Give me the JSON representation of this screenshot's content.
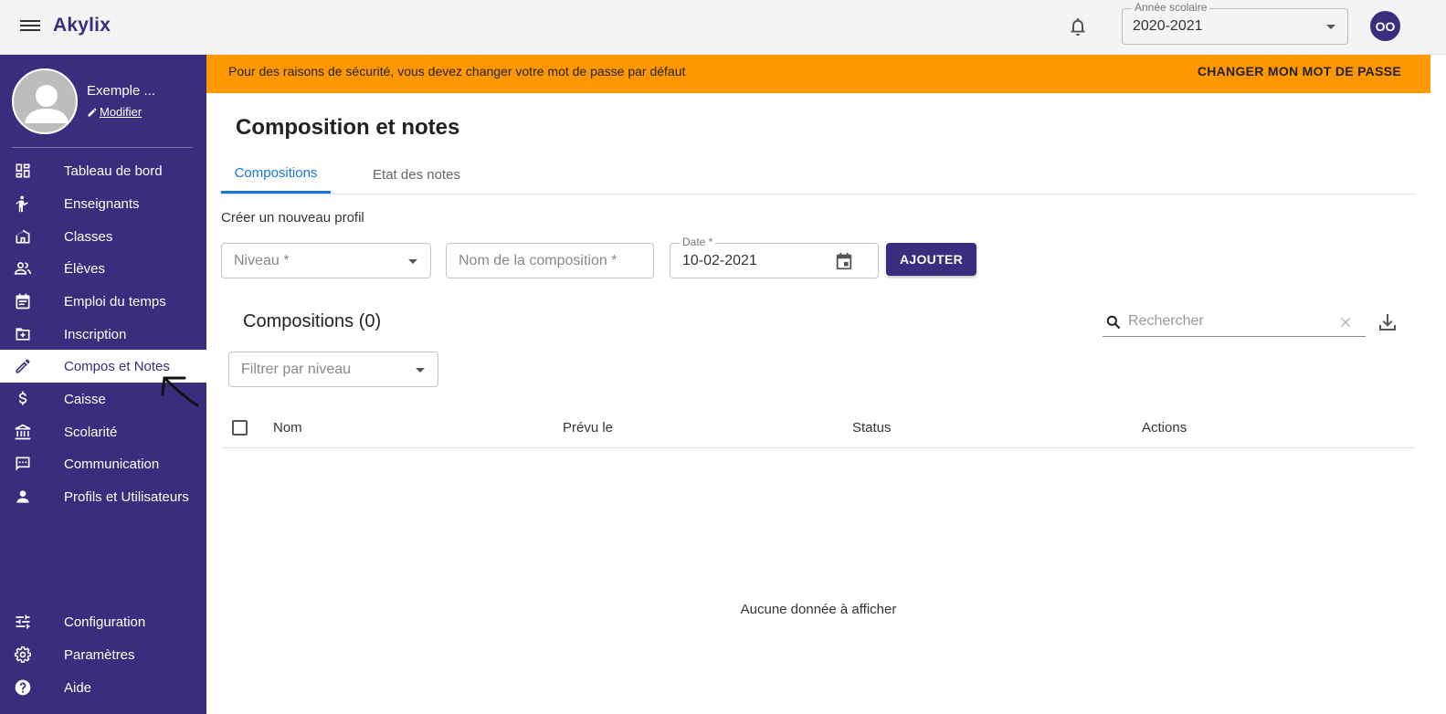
{
  "app": {
    "brand": "Akylix"
  },
  "topbar": {
    "year_label": "Année scolaire",
    "year_value": "2020-2021",
    "user_initials": "OO"
  },
  "sidebar": {
    "profile_name": "Exemple ...",
    "profile_edit": "Modifier",
    "items": [
      {
        "label": "Tableau de bord",
        "icon": "dashboard-icon"
      },
      {
        "label": "Enseignants",
        "icon": "teacher-icon"
      },
      {
        "label": "Classes",
        "icon": "building-icon"
      },
      {
        "label": "Élèves",
        "icon": "students-icon"
      },
      {
        "label": "Emploi du temps",
        "icon": "calendar-icon"
      },
      {
        "label": "Inscription",
        "icon": "folder-add-icon"
      },
      {
        "label": "Compos et Notes",
        "icon": "pencil-icon",
        "active": true
      },
      {
        "label": "Caisse",
        "icon": "dollar-icon"
      },
      {
        "label": "Scolarité",
        "icon": "bank-icon"
      },
      {
        "label": "Communication",
        "icon": "chat-icon"
      },
      {
        "label": "Profils et Utilisateurs",
        "icon": "person-icon"
      }
    ],
    "bottom_items": [
      {
        "label": "Configuration",
        "icon": "sliders-icon"
      },
      {
        "label": "Paramètres",
        "icon": "gear-icon"
      },
      {
        "label": "Aide",
        "icon": "help-icon"
      }
    ]
  },
  "alert": {
    "text": "Pour des raisons de sécurité, vous devez changer votre mot de passe par défaut",
    "action": "CHANGER MON MOT DE PASSE"
  },
  "main": {
    "title": "Composition et notes",
    "tabs": [
      {
        "label": "Compositions",
        "active": true
      },
      {
        "label": "Etat des notes",
        "active": false
      }
    ],
    "create_label": "Créer un nouveau profil",
    "form": {
      "niveau_placeholder": "Niveau *",
      "nom_placeholder": "Nom de la composition *",
      "date_label": "Date *",
      "date_value": "10-02-2021",
      "add_button": "AJOUTER"
    },
    "list_title": "Compositions (0)",
    "search_placeholder": "Rechercher",
    "filter_placeholder": "Filtrer par niveau",
    "table": {
      "columns": [
        "Nom",
        "Prévu le",
        "Status",
        "Actions"
      ],
      "empty_text": "Aucune donnée à afficher"
    }
  },
  "colors": {
    "primary": "#3a2d7e",
    "alert": "#ff9800",
    "tab_active": "#1976d2"
  }
}
